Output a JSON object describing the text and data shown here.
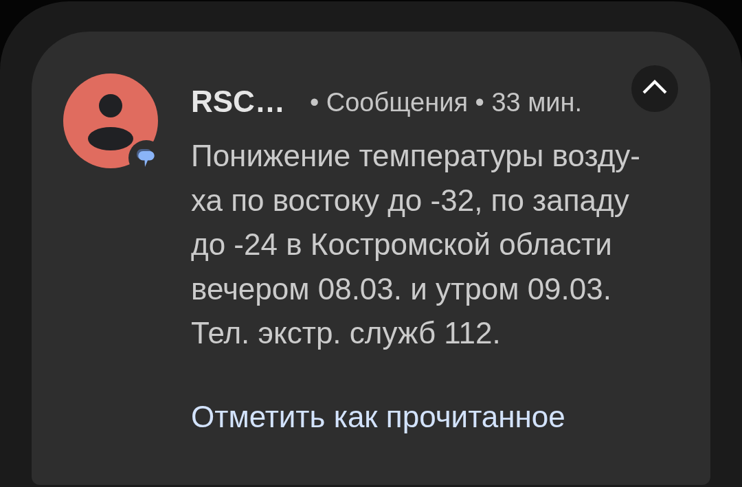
{
  "notification": {
    "sender": "RSC…",
    "header_info": "• Сообщения • 33 мин.",
    "expanded": true,
    "body": "Понижение температуры возду-\nха по востоку до -32, по западу\nдо -24 в Костромской области\nвечером 08.03. и утром 09.03.\nТел. экстр. служб 112.",
    "actions": [
      "Отметить как прочитанное"
    ]
  }
}
